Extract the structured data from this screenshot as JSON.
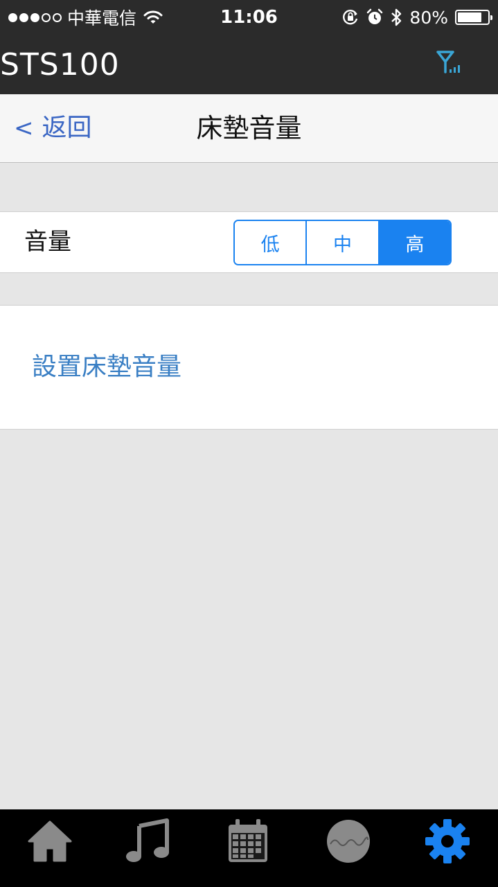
{
  "status_bar": {
    "signal_dots": [
      true,
      true,
      true,
      false,
      false
    ],
    "carrier": "中華電信",
    "time": "11:06",
    "battery_percent": "80%",
    "battery_level": 0.8,
    "icons": [
      "wifi-icon",
      "rotation-lock-icon",
      "alarm-icon",
      "bluetooth-icon",
      "battery-icon"
    ]
  },
  "app_header": {
    "title": "STS100",
    "icon": "signal-antenna-icon"
  },
  "nav": {
    "back_label": "返回",
    "back_chevron": "<",
    "title": "床墊音量"
  },
  "volume": {
    "label": "音量",
    "options": [
      "低",
      "中",
      "高"
    ],
    "selected": "高"
  },
  "set_action": {
    "label": "設置床墊音量"
  },
  "tab_bar": {
    "items": [
      {
        "icon": "home-icon",
        "active": false
      },
      {
        "icon": "music-note-icon",
        "active": false
      },
      {
        "icon": "calendar-icon",
        "active": false
      },
      {
        "icon": "wave-icon",
        "active": false
      },
      {
        "icon": "gear-icon",
        "active": true
      }
    ]
  },
  "colors": {
    "accent": "#1a82f0",
    "link": "#3a66c4",
    "dark_bar": "#2b2b2b",
    "tab_inactive": "#8a8a8a",
    "antenna": "#3aa6d6"
  }
}
